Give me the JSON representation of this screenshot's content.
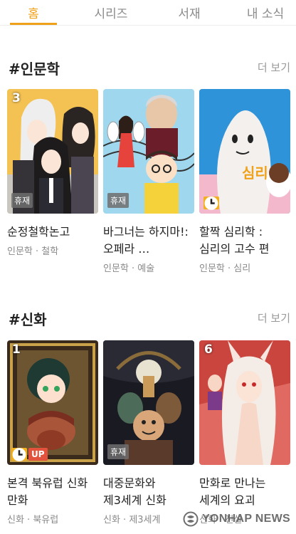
{
  "tabs": [
    {
      "label": "홈",
      "active": true
    },
    {
      "label": "시리즈",
      "active": false
    },
    {
      "label": "서재",
      "active": false
    },
    {
      "label": "내 소식",
      "active": false
    }
  ],
  "sections": [
    {
      "title": "#인문학",
      "more_label": "더 보기",
      "cards": [
        {
          "rank": "3",
          "badge": "휴재",
          "title": "순정철학논고",
          "meta": "인문학 · 철학"
        },
        {
          "rank": "",
          "badge": "휴재",
          "title": "바그너는 하지마!: 오페라 …",
          "meta": "인문학 · 예술"
        },
        {
          "rank": "",
          "badge": "",
          "title": "할짝 심리학 : 심리의 고수 편",
          "meta": "인문학 · 심리"
        }
      ]
    },
    {
      "title": "#신화",
      "more_label": "더 보기",
      "cards": [
        {
          "rank": "1",
          "badge": "UP",
          "title": "본격 북유럽 신화 만화",
          "meta": "신화 · 북유럽"
        },
        {
          "rank": "",
          "badge": "휴재",
          "title": "대중문화와 제3세계 신화",
          "meta": "신화 · 제3세계"
        },
        {
          "rank": "6",
          "badge": "",
          "title": "만화로 만나는 세계의 요괴",
          "meta": "신화 · 전설"
        }
      ]
    }
  ],
  "thumb_art_text": {
    "simri": "심리"
  },
  "watermark": "YONHAP NEWS",
  "colors": {
    "accent": "#f0a11a",
    "up_badge": "#e2523c",
    "clock_badge": "#f2b01e"
  }
}
